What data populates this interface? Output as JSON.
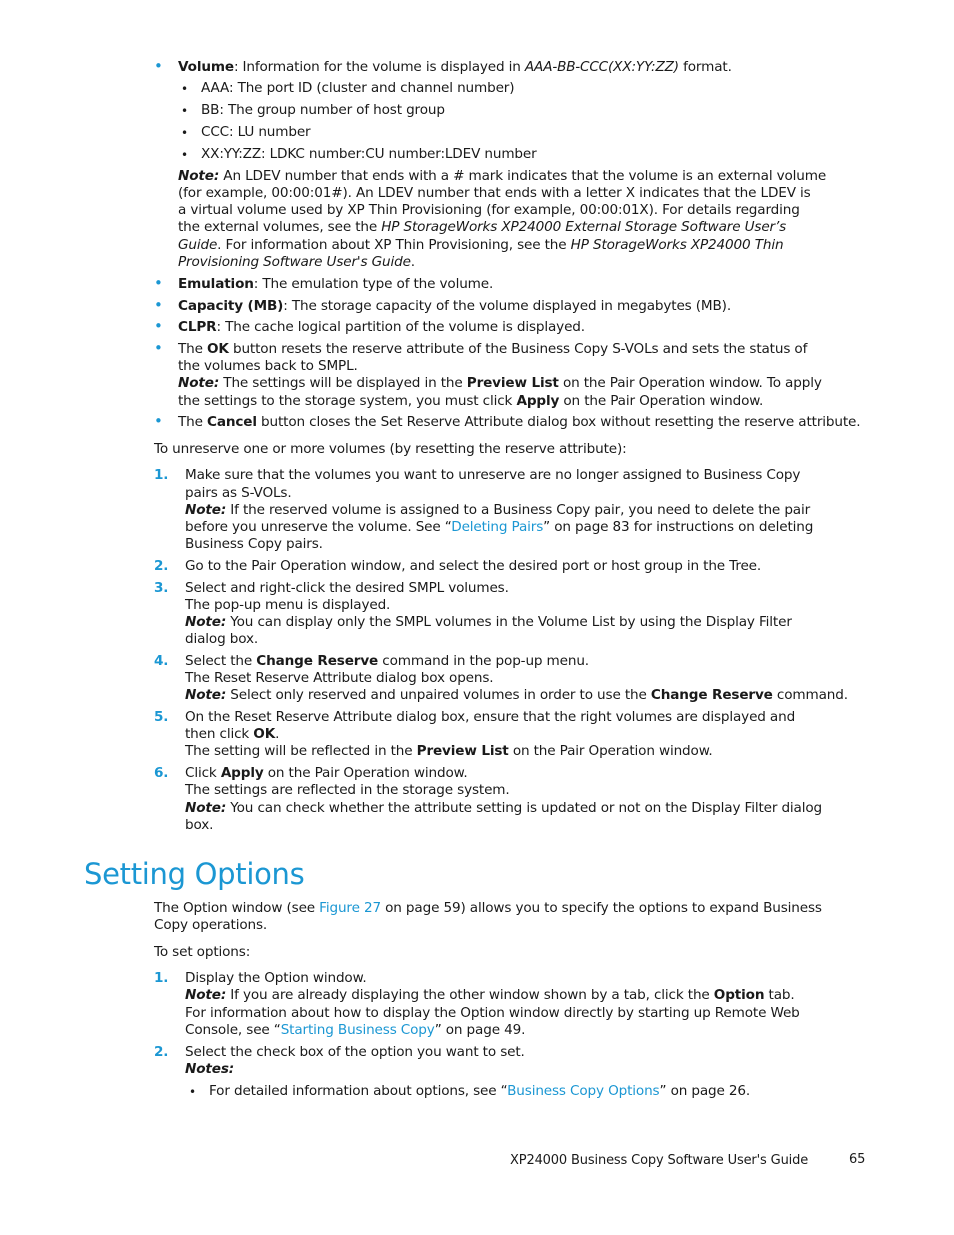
{
  "volume_item": {
    "term": "Volume",
    "text_a": ": Information for the volume is displayed in ",
    "format": "AAA-BB-CCC(XX:YY:ZZ)",
    "text_b": " format.",
    "sub_items": [
      "AAA: The port ID (cluster and channel number)",
      "BB: The group number of host group",
      "CCC: LU number",
      "XX:YY:ZZ: LDKC number:CU number:LDEV number"
    ],
    "note_label": "Note:",
    "note_lines": [
      " An LDEV number that ends with a # mark indicates that the volume is an external volume",
      "(for example, 00:00:01#).  An LDEV number that ends with a letter X indicates that the LDEV is",
      "a virtual volume used by XP Thin Provisioning (for example, 00:00:01X). For details regarding"
    ],
    "note_line4_a": "the external volumes, see the ",
    "note_line4_i": "HP StorageWorks XP24000 External Storage Software User’s",
    "note_line5_i": "Guide",
    "note_line5_a": ".  For information about XP Thin Provisioning, see the ",
    "note_line5_i2": "HP StorageWorks XP24000 Thin",
    "note_line6_i": "Provisioning Software User's Guide",
    "note_line6_a": "."
  },
  "emulation_item": {
    "term": "Emulation",
    "text": ":  The emulation type of the volume."
  },
  "capacity_item": {
    "term": "Capacity (MB)",
    "text": ": The storage capacity of the volume displayed in megabytes (MB)."
  },
  "clpr_item": {
    "term": "CLPR",
    "text": ": The cache logical partition of the volume is displayed."
  },
  "ok_item": {
    "pre": "The ",
    "term": "OK",
    "line1": " button resets the reserve attribute of the Business Copy S-VOLs and sets the status of",
    "line2": "the volumes back to SMPL.",
    "note_label": "Note:",
    "note_a": " The settings will be displayed in the ",
    "note_b": "Preview List",
    "note_c": " on the Pair Operation window.  To apply",
    "note2_a": "the settings to the storage system, you must click ",
    "note2_b": "Apply",
    "note2_c": " on the Pair Operation window."
  },
  "cancel_item": {
    "pre": "The ",
    "term": "Cancel",
    "text": " button closes the Set Reserve Attribute dialog box without resetting the reserve attribute."
  },
  "unreserve_intro": "To unreserve one or more volumes (by resetting the reserve attribute):",
  "unreserve_steps": [
    {
      "num": "1.",
      "line1": "Make sure that the volumes you want to unreserve are no longer assigned to Business Copy",
      "line2": "pairs as S-VOLs.",
      "note_label": "Note:",
      "note1": " If the reserved volume is assigned to a Business Copy pair, you need to delete the pair",
      "note2_a": "before you unreserve the volume.  See “",
      "note2_link": "Deleting Pairs",
      "note2_b": "” on page 83 for instructions on deleting",
      "note3": "Business Copy pairs."
    },
    {
      "num": "2.",
      "line1": "Go to the Pair Operation window, and select the desired port or host group in the Tree."
    },
    {
      "num": "3.",
      "line1": "Select and right-click the desired SMPL volumes.",
      "line2": "The pop-up menu is displayed.",
      "note_label": "Note:",
      "note1": " You can display only the SMPL volumes in the Volume List by using the Display Filter",
      "note2": "dialog box."
    },
    {
      "num": "4.",
      "line1_a": "Select the ",
      "line1_b": "Change Reserve",
      "line1_c": " command in the pop-up menu.",
      "line2": "The Reset Reserve Attribute dialog box opens.",
      "note_label": "Note:",
      "note_a": " Select only reserved and unpaired volumes in order to use the ",
      "note_b": "Change Reserve",
      "note_c": " command."
    },
    {
      "num": "5.",
      "line1": "On the Reset Reserve Attribute dialog box, ensure that the right volumes are displayed and",
      "line2_a": "then click ",
      "line2_b": "OK",
      "line2_c": ".",
      "line3_a": "The setting will be reflected in the ",
      "line3_b": "Preview List",
      "line3_c": " on the Pair Operation window."
    },
    {
      "num": "6.",
      "line1_a": "Click ",
      "line1_b": "Apply",
      "line1_c": " on the Pair Operation window.",
      "line2": "The settings are reflected in the storage system.",
      "note_label": "Note:",
      "note1": " You can check whether the attribute setting is updated or not on the Display Filter dialog",
      "note2": "box."
    }
  ],
  "section": {
    "title": "Setting Options",
    "intro_a": "The Option window (see ",
    "intro_link": "Figure 27",
    "intro_b": " on page 59) allows you to specify the options to expand Business",
    "intro_line2": "Copy operations.",
    "to_set": "To set options:",
    "steps": [
      {
        "num": "1.",
        "line1": "Display the Option window.",
        "note_label": "Note:",
        "note_a": " If you are already displaying the other window shown by a tab, click the ",
        "note_b": "Option",
        "note_c": " tab.",
        "line3": "For information about how to display the Option window directly by starting up Remote Web",
        "line4_a": "Console, see “",
        "line4_link": "Starting Business Copy",
        "line4_b": "” on page 49."
      },
      {
        "num": "2.",
        "line1": "Select the check box of the option you want to set.",
        "notes_label": "Notes:",
        "bullet_a": "For detailed information about options, see “",
        "bullet_link": "Business Copy Options",
        "bullet_b": "” on page 26."
      }
    ]
  },
  "footer": {
    "title": "XP24000 Business Copy Software User's Guide",
    "page": "65"
  },
  "colors": {
    "accent": "#1b97d3",
    "text": "#1a1a1a"
  }
}
